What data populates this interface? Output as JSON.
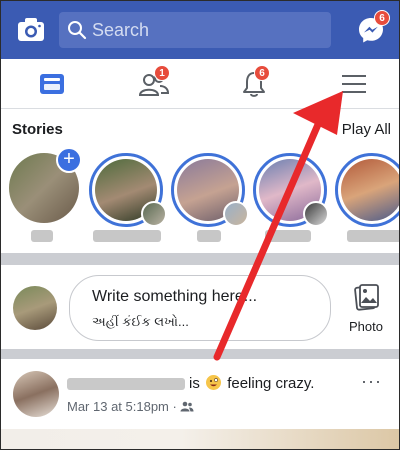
{
  "search": {
    "placeholder": "Search"
  },
  "header": {
    "messenger_badge": "6"
  },
  "tabs": {
    "friends_badge": "1",
    "notifications_badge": "6"
  },
  "stories": {
    "title": "Stories",
    "play_all": "Play All"
  },
  "composer": {
    "line1": "Write something here...",
    "line2": "અહીં કંઈક લખો...",
    "photo_label": "Photo"
  },
  "post": {
    "text_is": "is",
    "text_feeling": "feeling crazy.",
    "meta": "Mar 13 at 5:18pm",
    "more": "···"
  },
  "colors": {
    "brand_blue": "#3b5bb3",
    "badge_red": "#e74c3c",
    "story_ring": "#3f72d8",
    "arrow_red": "#e8292b"
  },
  "icons": {
    "camera": "camera-icon",
    "search": "search-icon",
    "messenger": "messenger-icon",
    "news_feed": "news-feed-icon",
    "friends": "friends-icon",
    "bell": "bell-icon",
    "menu": "hamburger-menu-icon",
    "photo": "photo-icon",
    "audience": "friends-audience-icon"
  }
}
